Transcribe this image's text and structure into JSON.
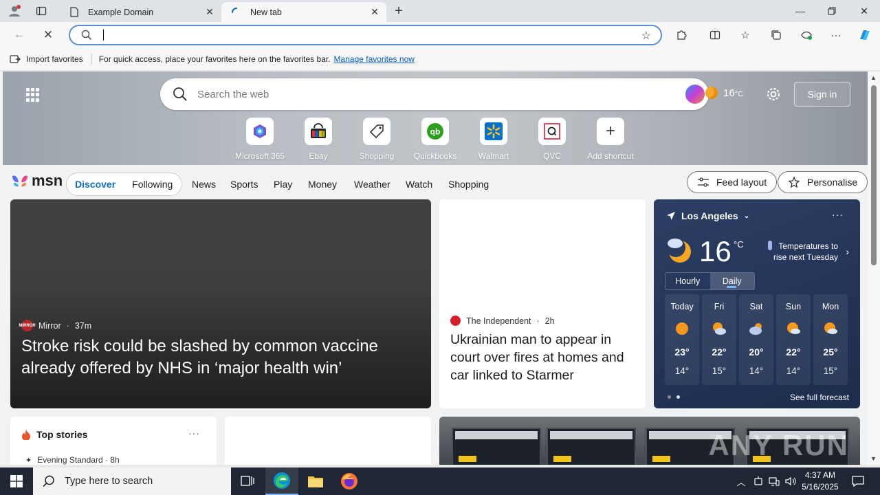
{
  "browser": {
    "tabs": [
      {
        "title": "Example Domain"
      },
      {
        "title": "New tab"
      }
    ],
    "address": {
      "value": ""
    },
    "favorites_bar": {
      "import_label": "Import favorites",
      "hint": "For quick access, place your favorites here on the favorites bar.",
      "manage_link": "Manage favorites now"
    }
  },
  "newtab": {
    "search": {
      "placeholder": "Search the web"
    },
    "header_weather": {
      "temp": "16",
      "unit": "°C"
    },
    "signin_label": "Sign in",
    "shortcuts": [
      {
        "label": "Microsoft 365",
        "icon": "microsoft365-icon"
      },
      {
        "label": "Ebay",
        "icon": "ebay-icon"
      },
      {
        "label": "Shopping",
        "icon": "tag-icon"
      },
      {
        "label": "Quickbooks",
        "icon": "quickbooks-icon"
      },
      {
        "label": "Walmart",
        "icon": "walmart-icon"
      },
      {
        "label": "QVC",
        "icon": "qvc-icon"
      },
      {
        "label": "Add shortcut",
        "icon": "plus-icon"
      }
    ]
  },
  "msn": {
    "logo_text": "msn",
    "feed_switch": {
      "discover": "Discover",
      "following": "Following"
    },
    "nav": [
      "News",
      "Sports",
      "Play",
      "Money",
      "Weather",
      "Watch",
      "Shopping"
    ],
    "feed_layout_label": "Feed layout",
    "personalise_label": "Personalise"
  },
  "cards": {
    "main": {
      "source": "Mirror",
      "source_logo": "MIRROR",
      "time": "37m",
      "headline": "Stroke risk could be slashed by common vaccine already offered by NHS in ‘major health win’"
    },
    "second": {
      "source": "The Independent",
      "time": "2h",
      "headline": "Ukrainian man to appear in court over fires at homes and car linked to Starmer"
    },
    "top_stories": {
      "title": "Top stories",
      "source": "Evening Standard",
      "time": "8h"
    },
    "watermark": "ANY RUN"
  },
  "weather": {
    "location": "Los Angeles",
    "temp": "16",
    "unit": "°C",
    "note": "Temperatures to rise next Tuesday",
    "tabs": [
      "Hourly",
      "Daily"
    ],
    "selected_tab": "Daily",
    "days": [
      {
        "name": "Today",
        "hi": "23°",
        "lo": "14°",
        "icon": "sun-icon"
      },
      {
        "name": "Fri",
        "hi": "22°",
        "lo": "15°",
        "icon": "partly-cloudy-icon"
      },
      {
        "name": "Sat",
        "hi": "20°",
        "lo": "14°",
        "icon": "cloudy-icon"
      },
      {
        "name": "Sun",
        "hi": "22°",
        "lo": "14°",
        "icon": "partly-sunny-icon"
      },
      {
        "name": "Mon",
        "hi": "25°",
        "lo": "15°",
        "icon": "partly-sunny-icon"
      }
    ],
    "forecast_link": "See full forecast"
  },
  "taskbar": {
    "search_placeholder": "Type here to search",
    "time": "4:37 AM",
    "date": "5/16/2025"
  },
  "colors": {
    "accent": "#0f6cbd",
    "omnibox_border": "#5b8fd7",
    "taskbar": "#1e2733",
    "weather_card": "#25365a"
  }
}
